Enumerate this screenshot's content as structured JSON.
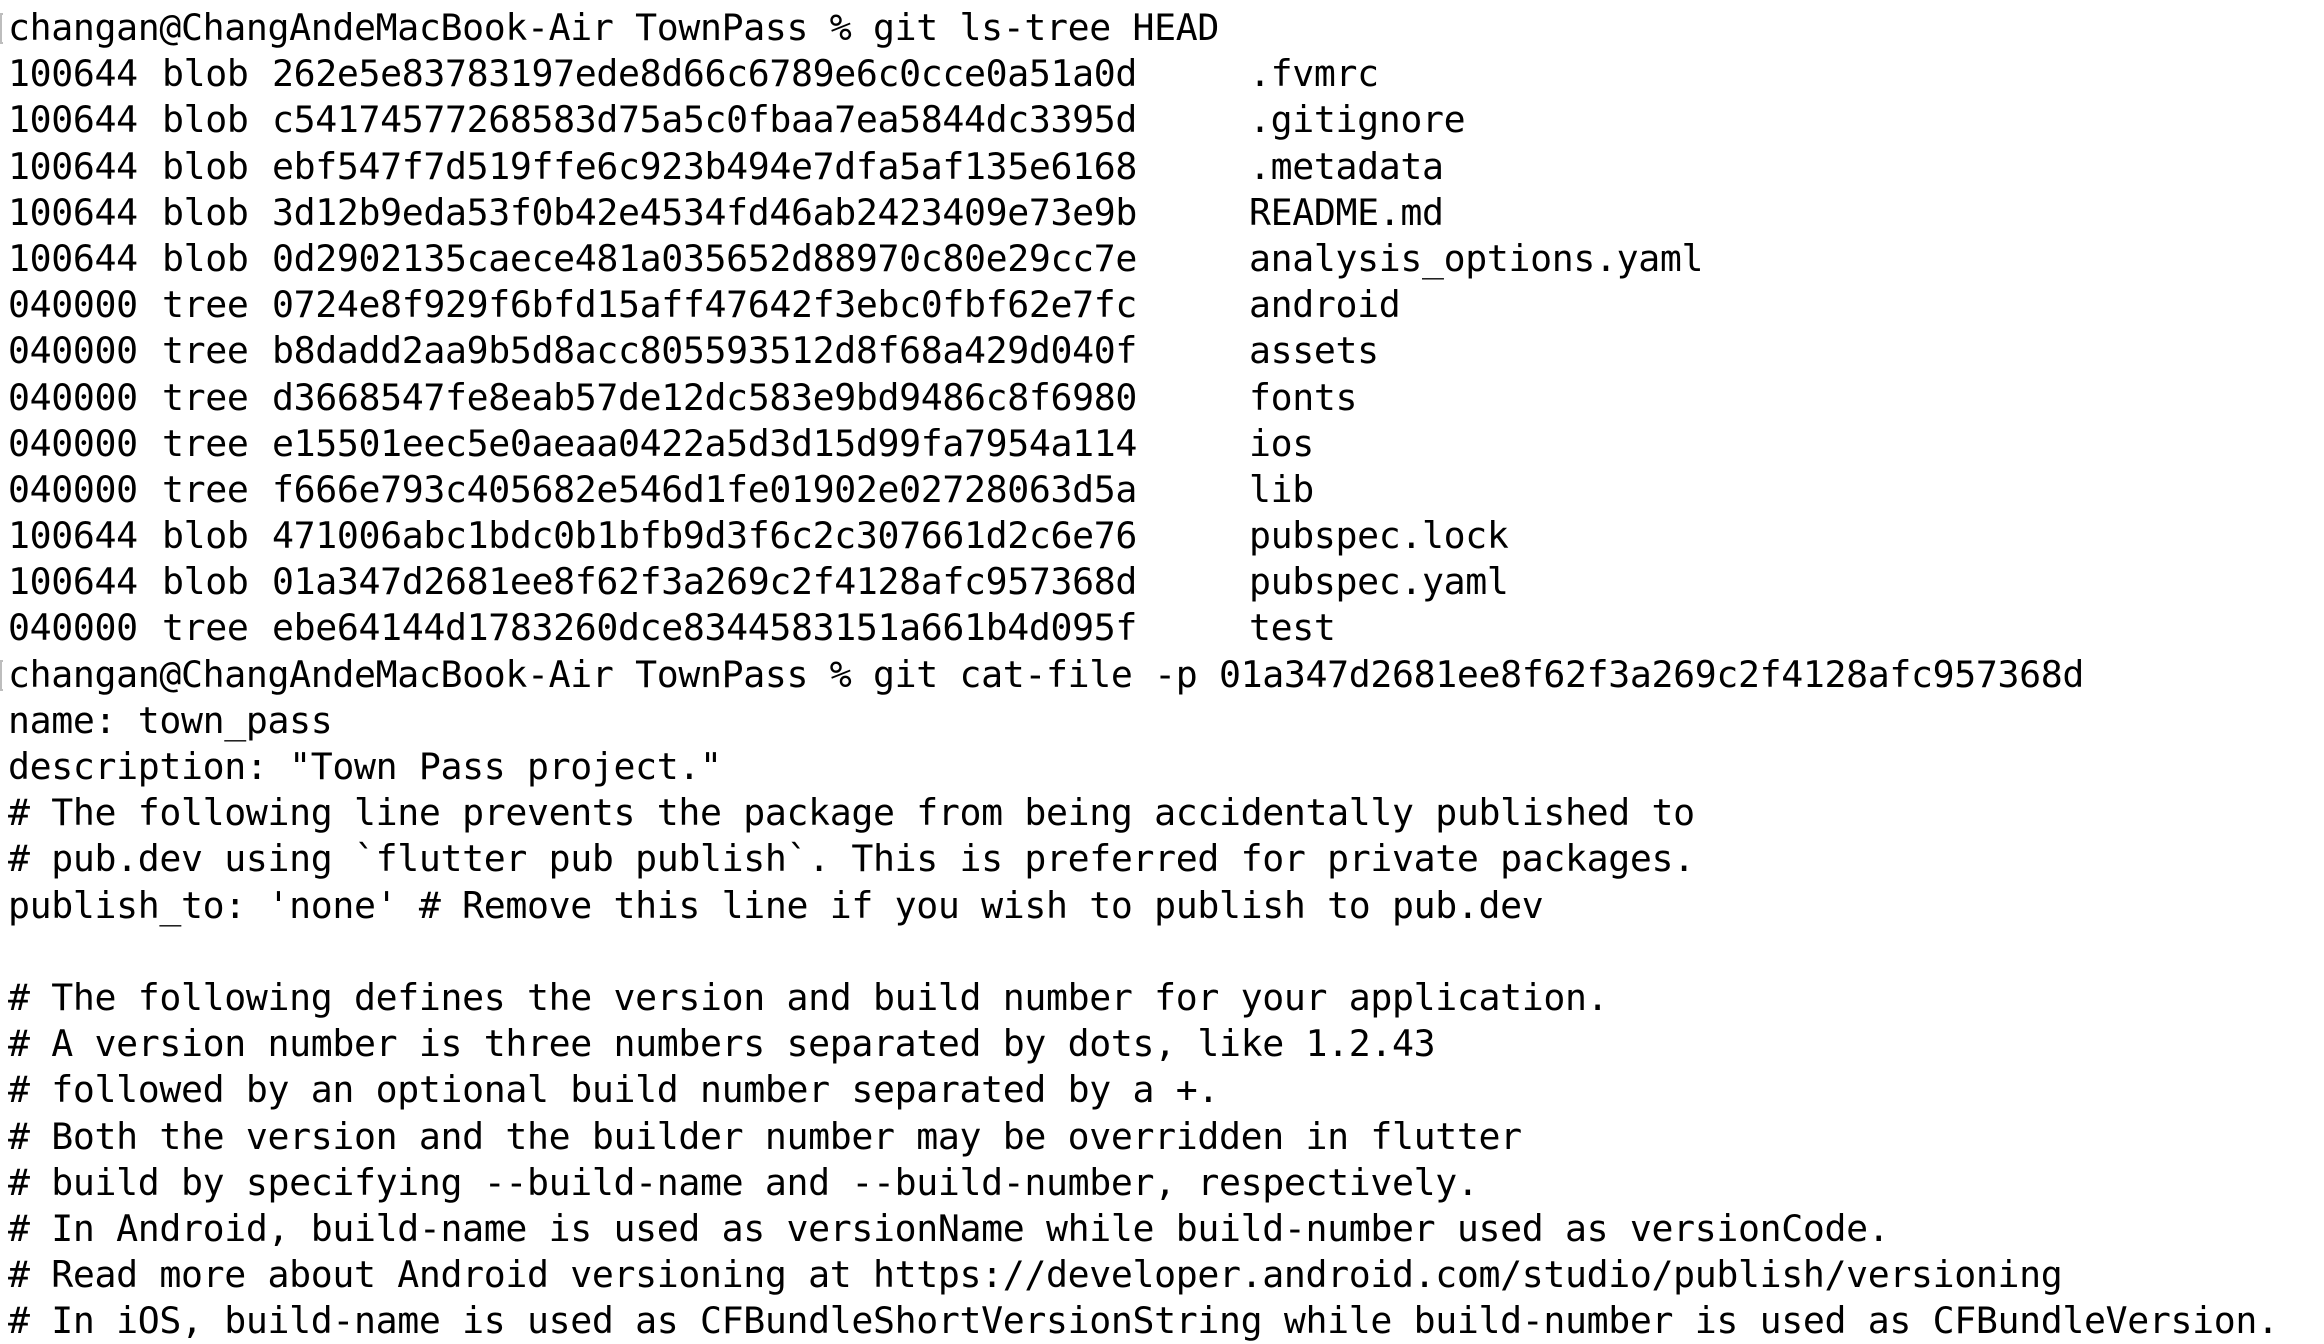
{
  "prompt": {
    "user_host": "changan@ChangAndeMacBook-Air",
    "directory": "TownPass",
    "symbol": "%"
  },
  "command_1": "git ls-tree HEAD",
  "entries": [
    {
      "mode": "100644",
      "type": "blob",
      "hash": "262e5e83783197ede8d66c6789e6c0cce0a51a0d",
      "name": ".fvmrc"
    },
    {
      "mode": "100644",
      "type": "blob",
      "hash": "c54174577268583d75a5c0fbaa7ea5844dc3395d",
      "name": ".gitignore"
    },
    {
      "mode": "100644",
      "type": "blob",
      "hash": "ebf547f7d519ffe6c923b494e7dfa5af135e6168",
      "name": ".metadata"
    },
    {
      "mode": "100644",
      "type": "blob",
      "hash": "3d12b9eda53f0b42e4534fd46ab2423409e73e9b",
      "name": "README.md"
    },
    {
      "mode": "100644",
      "type": "blob",
      "hash": "0d2902135caece481a035652d88970c80e29cc7e",
      "name": "analysis_options.yaml"
    },
    {
      "mode": "040000",
      "type": "tree",
      "hash": "0724e8f929f6bfd15aff47642f3ebc0fbf62e7fc",
      "name": "android"
    },
    {
      "mode": "040000",
      "type": "tree",
      "hash": "b8dadd2aa9b5d8acc805593512d8f68a429d040f",
      "name": "assets"
    },
    {
      "mode": "040000",
      "type": "tree",
      "hash": "d3668547fe8eab57de12dc583e9bd9486c8f6980",
      "name": "fonts"
    },
    {
      "mode": "040000",
      "type": "tree",
      "hash": "e15501eec5e0aeaa0422a5d3d15d99fa7954a114",
      "name": "ios"
    },
    {
      "mode": "040000",
      "type": "tree",
      "hash": "f666e793c405682e546d1fe01902e02728063d5a",
      "name": "lib"
    },
    {
      "mode": "100644",
      "type": "blob",
      "hash": "471006abc1bdc0b1bfb9d3f6c2c307661d2c6e76",
      "name": "pubspec.lock"
    },
    {
      "mode": "100644",
      "type": "blob",
      "hash": "01a347d2681ee8f62f3a269c2f4128afc957368d",
      "name": "pubspec.yaml"
    },
    {
      "mode": "040000",
      "type": "tree",
      "hash": "ebe64144d1783260dce8344583151a661b4d095f",
      "name": "test"
    }
  ],
  "command_2": "git cat-file -p 01a347d2681ee8f62f3a269c2f4128afc957368d",
  "output": [
    "name: town_pass",
    "description: \"Town Pass project.\"",
    "# The following line prevents the package from being accidentally published to",
    "# pub.dev using `flutter pub publish`. This is preferred for private packages.",
    "publish_to: 'none' # Remove this line if you wish to publish to pub.dev",
    "",
    "# The following defines the version and build number for your application.",
    "# A version number is three numbers separated by dots, like 1.2.43",
    "# followed by an optional build number separated by a +.",
    "# Both the version and the builder number may be overridden in flutter",
    "# build by specifying --build-name and --build-number, respectively.",
    "# In Android, build-name is used as versionName while build-number used as versionCode.",
    "# Read more about Android versioning at https://developer.android.com/studio/publish/versioning",
    "# In iOS, build-name is used as CFBundleShortVersionString while build-number is used as CFBundleVersion."
  ]
}
